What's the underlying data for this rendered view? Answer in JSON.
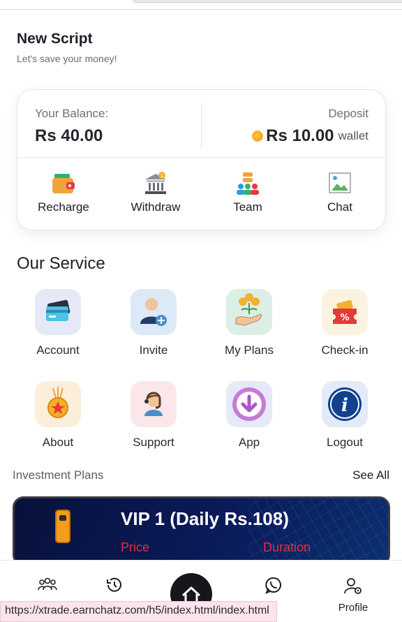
{
  "header": {
    "title": "New Script",
    "subtitle": "Let's save your money!"
  },
  "balance": {
    "label": "Your Balance:",
    "value": "Rs 40.00",
    "deposit_label": "Deposit",
    "deposit_value": "Rs 10.00",
    "deposit_suffix": "wallet"
  },
  "actions": [
    {
      "label": "Recharge",
      "icon": "wallet-icon"
    },
    {
      "label": "Withdraw",
      "icon": "bank-icon"
    },
    {
      "label": "Team",
      "icon": "team-icon"
    },
    {
      "label": "Chat",
      "icon": "broken-image-icon"
    }
  ],
  "service": {
    "title": "Our Service",
    "items": [
      {
        "label": "Account",
        "icon": "card-icon"
      },
      {
        "label": "Invite",
        "icon": "add-user-icon"
      },
      {
        "label": "My Plans",
        "icon": "money-plant-icon"
      },
      {
        "label": "Check-in",
        "icon": "ticket-percent-icon"
      },
      {
        "label": "About",
        "icon": "medal-icon"
      },
      {
        "label": "Support",
        "icon": "headset-agent-icon"
      },
      {
        "label": "App",
        "icon": "download-icon"
      },
      {
        "label": "Logout",
        "icon": "info-icon"
      }
    ]
  },
  "investment": {
    "title": "Investment Plans",
    "see_all": "See All",
    "plan": {
      "title": "VIP 1 (Daily Rs.108)",
      "price_label": "Price",
      "duration_label": "Duration"
    }
  },
  "bottom_nav": {
    "profile_label": "Profile"
  },
  "status_url": "https://xtrade.earnchatz.com/h5/index.html/index.html",
  "colors": {
    "accent_red": "#e2303c",
    "card_bg": "#0a1b5a",
    "home_button": "#16161b"
  }
}
